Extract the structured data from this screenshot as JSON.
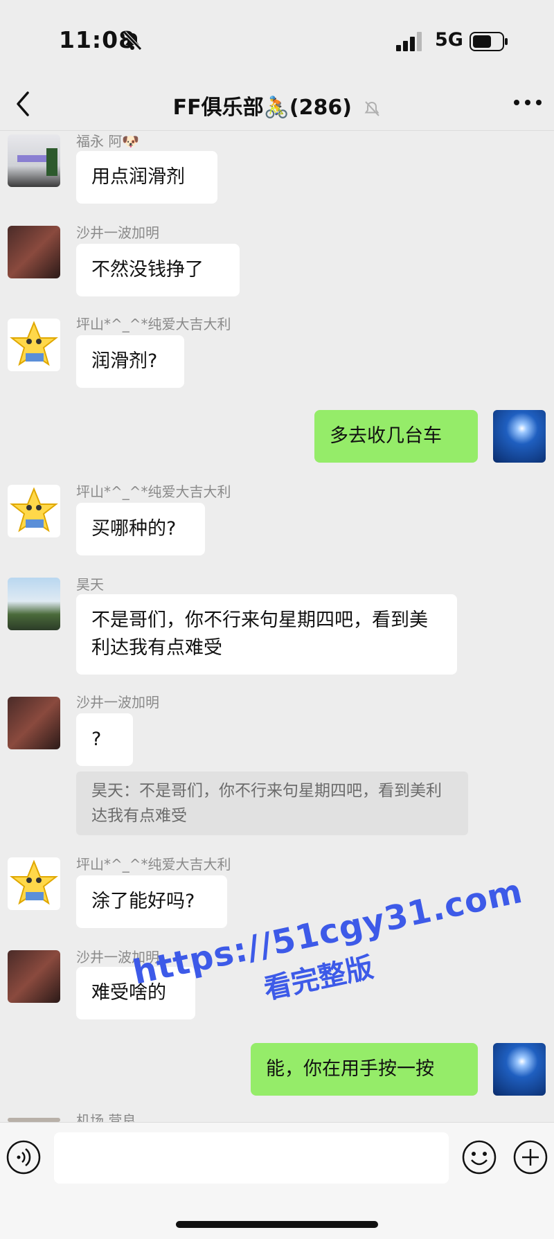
{
  "status": {
    "time": "11:08",
    "network": "5G"
  },
  "header": {
    "group_name": "FF俱乐部🚴(286)"
  },
  "messages": [
    {
      "sender": "福永 阿🐶",
      "text": "用点润滑剂"
    },
    {
      "sender": "沙井一波加明",
      "text": "不然没钱挣了"
    },
    {
      "sender": "坪山*^_^*纯爱大吉大利",
      "text": "润滑剂?"
    },
    {
      "sender": "",
      "text": "多去收几台车"
    },
    {
      "sender": "坪山*^_^*纯爱大吉大利",
      "text": "买哪种的?"
    },
    {
      "sender": "昊天",
      "text": "不是哥们，你不行来句星期四吧，看到美利达我有点难受"
    },
    {
      "sender": "沙井一波加明",
      "text": "?",
      "quote": "昊天：不是哥们，你不行来句星期四吧，看到美利达我有点难受"
    },
    {
      "sender": "坪山*^_^*纯爱大吉大利",
      "text": "涂了能好吗?"
    },
    {
      "sender": "沙井一波加明",
      "text": "难受啥的"
    },
    {
      "sender": "",
      "text": "能，你在用手按一按"
    },
    {
      "sender": "机场 营良",
      "text": ""
    }
  ],
  "watermark": {
    "line1": "https://51cgy31.com",
    "line2": "看完整版"
  },
  "input": {
    "placeholder": ""
  }
}
